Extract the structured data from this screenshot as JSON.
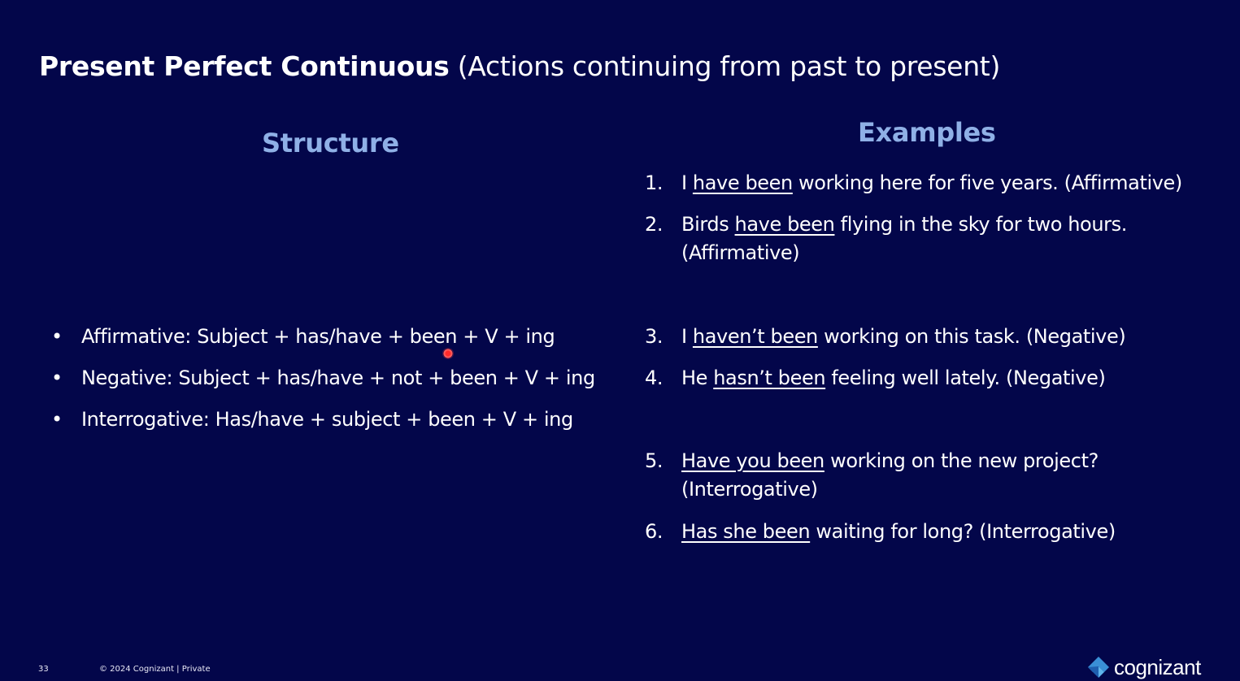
{
  "slide": {
    "title_bold": "Present Perfect Continuous",
    "title_rest": " (Actions continuing from past to present)",
    "structure_heading": "Structure",
    "examples_heading": "Examples",
    "bullet_glyph": "•",
    "structure_items": [
      "Affirmative: Subject + has/have + been + V + ing",
      "Negative: Subject + has/have + not + been + V + ing",
      "Interrogative: Has/have + subject + been + V + ing"
    ],
    "examples": [
      {
        "num": "1.",
        "pre": "I ",
        "underlined": "have been",
        "post": " working here for five years. (Affirmative)",
        "line2": ""
      },
      {
        "num": "2.",
        "pre": "Birds ",
        "underlined": "have been",
        "post": " flying in the sky for two hours.",
        "line2": "(Affirmative)"
      },
      {
        "num": "3.",
        "pre": "I ",
        "underlined": "haven’t been",
        "post": " working on this task. (Negative)",
        "line2": ""
      },
      {
        "num": "4.",
        "pre": "He ",
        "underlined": "hasn’t been",
        "post": " feeling well lately. (Negative)",
        "line2": ""
      },
      {
        "num": "5.",
        "pre": "",
        "underlined": "Have you been",
        "post": " working on the new project?",
        "line2": "(Interrogative)"
      },
      {
        "num": "6.",
        "pre": "",
        "underlined": "Has she been",
        "post": " waiting for long? (Interrogative)",
        "line2": ""
      }
    ]
  },
  "footer": {
    "page_number": "33",
    "copyright": "© 2024 Cognizant | Private",
    "logo_text": "cognizant"
  },
  "colors": {
    "background": "#03064a",
    "heading_accent": "#8fb0e6",
    "text": "#ffffff"
  },
  "icons": {
    "laser_pointer": "laser-pointer-icon",
    "logo": "cognizant-logo-icon"
  }
}
